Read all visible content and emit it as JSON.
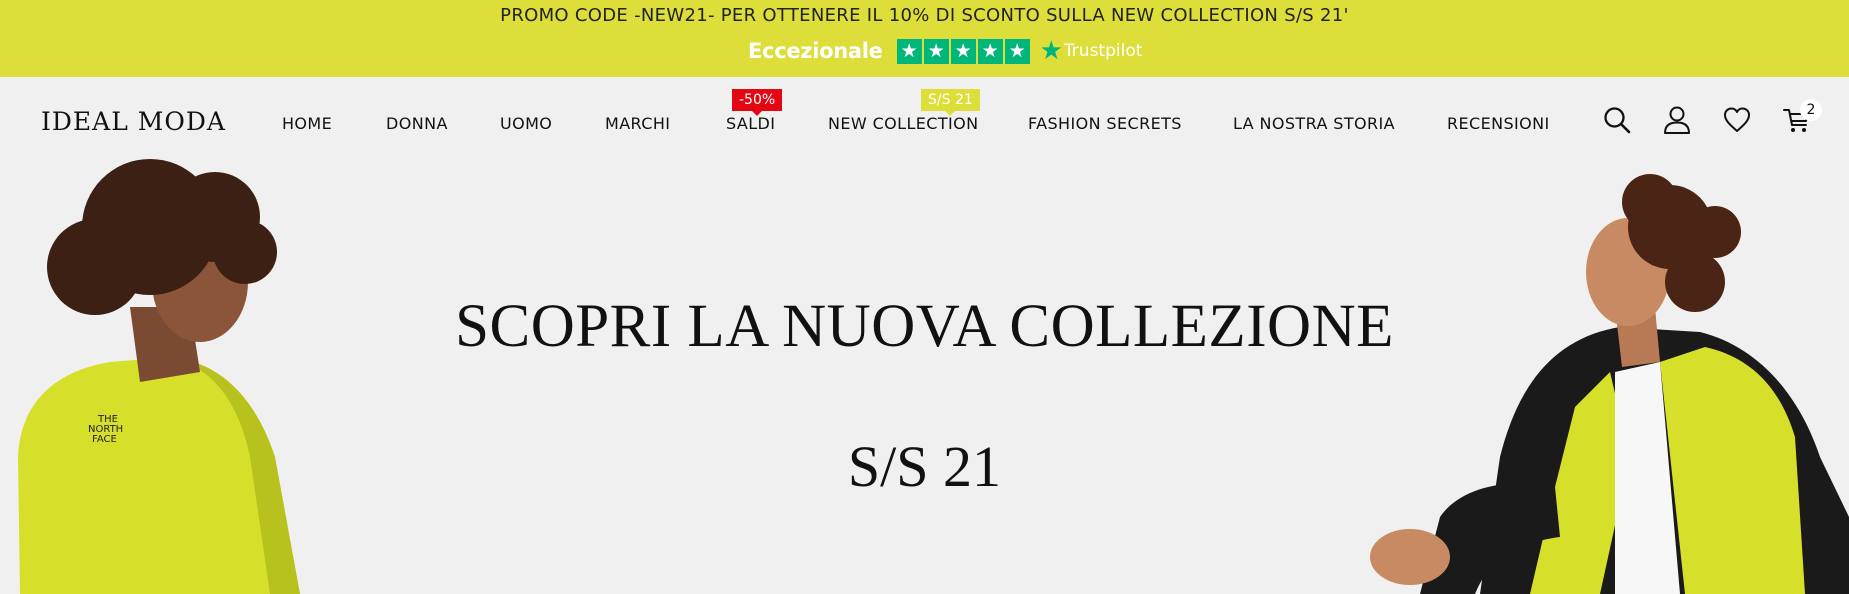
{
  "promo": {
    "text": "PROMO CODE -NEW21- PER OTTENERE IL 10% DI SCONTO SULLA NEW COLLECTION S/S 21'",
    "rating_label": "Eccezionale",
    "trustpilot_label": "Trustpilot",
    "stars": 5,
    "star_color": "#00b67a",
    "bg_color": "#dede3a"
  },
  "header": {
    "logo": "IDEAL  MODA",
    "nav": [
      {
        "label": "HOME"
      },
      {
        "label": "DONNA"
      },
      {
        "label": "UOMO"
      },
      {
        "label": "MARCHI"
      },
      {
        "label": "SALDI",
        "badge": "-50%"
      },
      {
        "label": "NEW COLLECTION",
        "badge": "S/S 21"
      },
      {
        "label": "FASHION SECRETS"
      },
      {
        "label": "LA NOSTRA STORIA"
      },
      {
        "label": "RECENSIONI"
      }
    ],
    "icons": [
      "search-icon",
      "user-icon",
      "heart-icon",
      "cart-icon"
    ],
    "cart_count": "2"
  },
  "hero": {
    "title": "SCOPRI LA NUOVA COLLEZIONE",
    "subtitle": "S/S 21",
    "accent_color": "#d6df2a"
  }
}
